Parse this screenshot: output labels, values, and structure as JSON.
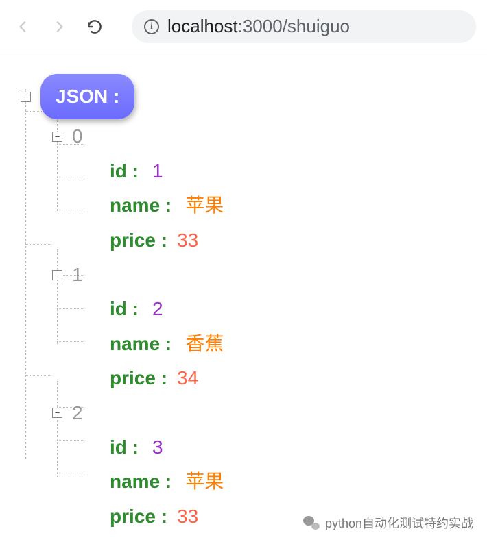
{
  "browser": {
    "url_host": "localhost",
    "url_rest": ":3000/shuiguo"
  },
  "json_viewer": {
    "root_label": "JSON :",
    "items": [
      {
        "index": "0",
        "fields": {
          "id_key": "id :",
          "id_val": "1",
          "name_key": "name :",
          "name_val": "苹果",
          "price_key": "price :",
          "price_val": "33"
        }
      },
      {
        "index": "1",
        "fields": {
          "id_key": "id :",
          "id_val": "2",
          "name_key": "name :",
          "name_val": "香蕉",
          "price_key": "price :",
          "price_val": "34"
        }
      },
      {
        "index": "2",
        "fields": {
          "id_key": "id :",
          "id_val": "3",
          "name_key": "name :",
          "name_val": "苹果",
          "price_key": "price :",
          "price_val": "33"
        }
      }
    ]
  },
  "watermark": {
    "text": "python自动化测试特约实战"
  },
  "toggle_glyph": "⊟"
}
